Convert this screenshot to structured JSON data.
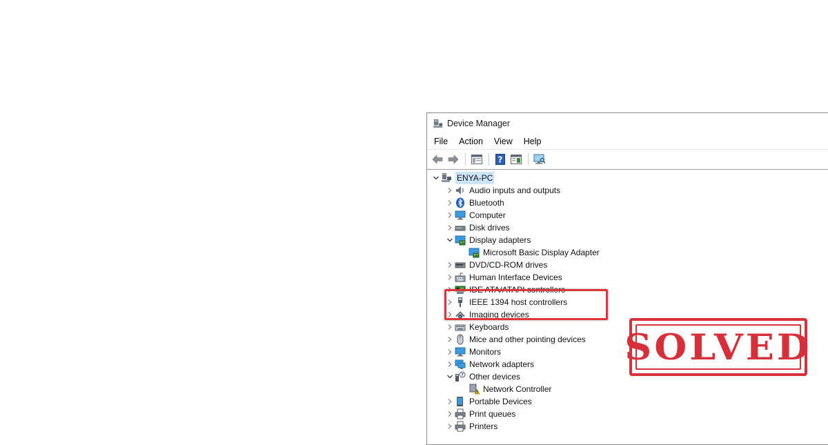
{
  "window": {
    "title": "Device Manager",
    "title_icon": "device-manager-icon"
  },
  "menu": [
    "File",
    "Action",
    "View",
    "Help"
  ],
  "toolbar": [
    "back-arrow-icon",
    "forward-arrow-icon",
    "properties-icon",
    "help-icon",
    "update-driver-icon",
    "scan-hardware-icon"
  ],
  "tree": {
    "root": {
      "label": "ENYA-PC",
      "icon": "computer-icon",
      "expanded": true
    },
    "items": [
      {
        "label": "Audio inputs and outputs",
        "icon": "speaker-icon",
        "expanded": false
      },
      {
        "label": "Bluetooth",
        "icon": "bluetooth-icon",
        "expanded": false
      },
      {
        "label": "Computer",
        "icon": "monitor-icon",
        "expanded": false
      },
      {
        "label": "Disk drives",
        "icon": "disk-drive-icon",
        "expanded": false
      },
      {
        "label": "Display adapters",
        "icon": "display-adapter-icon",
        "expanded": true,
        "children": [
          {
            "label": "Microsoft Basic Display Adapter",
            "icon": "display-adapter-icon"
          }
        ]
      },
      {
        "label": "DVD/CD-ROM drives",
        "icon": "dvd-drive-icon",
        "expanded": false
      },
      {
        "label": "Human Interface Devices",
        "icon": "hid-icon",
        "expanded": false
      },
      {
        "label": "IDE ATA/ATAPI controllers",
        "icon": "ide-controller-icon",
        "expanded": false
      },
      {
        "label": "IEEE 1394 host controllers",
        "icon": "ieee1394-icon",
        "expanded": false
      },
      {
        "label": "Imaging devices",
        "icon": "camera-icon",
        "expanded": false
      },
      {
        "label": "Keyboards",
        "icon": "keyboard-icon",
        "expanded": false
      },
      {
        "label": "Mice and other pointing devices",
        "icon": "mouse-icon",
        "expanded": false
      },
      {
        "label": "Monitors",
        "icon": "monitor-icon",
        "expanded": false
      },
      {
        "label": "Network adapters",
        "icon": "network-adapter-icon",
        "expanded": false
      },
      {
        "label": "Other devices",
        "icon": "unknown-device-icon",
        "expanded": true,
        "children": [
          {
            "label": "Network Controller",
            "icon": "warning-device-icon"
          }
        ]
      },
      {
        "label": "Portable Devices",
        "icon": "portable-device-icon",
        "expanded": false
      },
      {
        "label": "Print queues",
        "icon": "printer-icon",
        "expanded": false
      },
      {
        "label": "Printers",
        "icon": "printer-icon",
        "expanded": false
      }
    ]
  },
  "stamp": {
    "text": "SOLVED",
    "color": "#d8303a"
  },
  "colors": {
    "highlight_border": "#e0343a",
    "selection": "#cce4f7"
  }
}
